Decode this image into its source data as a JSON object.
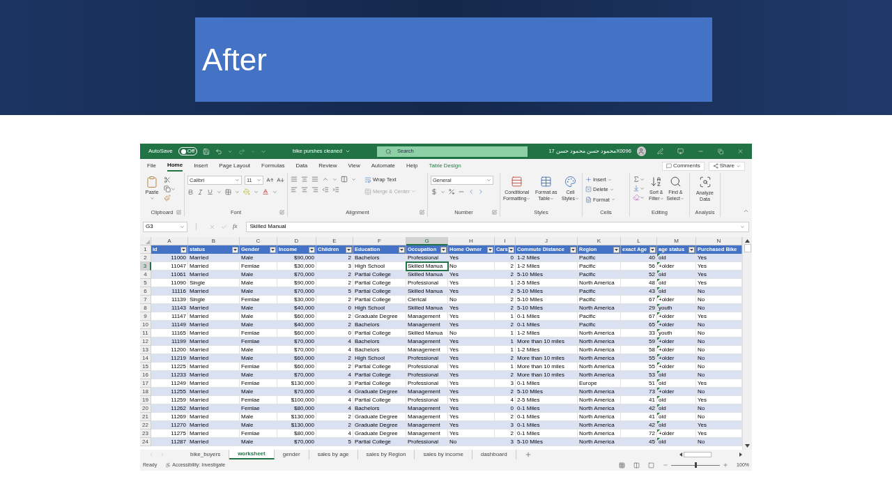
{
  "slide": {
    "title": "After"
  },
  "excel": {
    "title_bar": {
      "autosave_label": "AutoSave",
      "autosave": {
        "label": "Off",
        "on": false
      },
      "filename": "bike purshes cleaned",
      "search_placeholder": "Search",
      "user": "17 محمود حسن محمود حسنX0096"
    },
    "menu_tabs": [
      {
        "label": "File",
        "selected": false,
        "kind": "standard"
      },
      {
        "label": "Home",
        "selected": true,
        "kind": "standard"
      },
      {
        "label": "Insert",
        "selected": false,
        "kind": "standard"
      },
      {
        "label": "Page Layout",
        "selected": false,
        "kind": "standard"
      },
      {
        "label": "Formulas",
        "selected": false,
        "kind": "standard"
      },
      {
        "label": "Data",
        "selected": false,
        "kind": "standard"
      },
      {
        "label": "Review",
        "selected": false,
        "kind": "standard"
      },
      {
        "label": "View",
        "selected": false,
        "kind": "standard"
      },
      {
        "label": "Automate",
        "selected": false,
        "kind": "standard"
      },
      {
        "label": "Help",
        "selected": false,
        "kind": "standard"
      },
      {
        "label": "Table Design",
        "selected": false,
        "kind": "contextual"
      }
    ],
    "comments_button": "Comments",
    "share_button": "Share",
    "ribbon": {
      "paste": "Paste",
      "font_name": "Calibri",
      "font_size": "11",
      "wrap_text": "Wrap Text",
      "merge": {
        "label": "Merge & Center",
        "disabled": true
      },
      "number_format": "General",
      "styles": [
        {
          "kind": "conditional",
          "lines": [
            "Conditional",
            "Formatting"
          ]
        },
        {
          "kind": "table",
          "lines": [
            "Format as",
            "Table"
          ]
        },
        {
          "kind": "cell",
          "lines": [
            "Cell",
            "Styles"
          ]
        }
      ],
      "cells": [
        {
          "kind": "insert",
          "label": "Insert"
        },
        {
          "kind": "delete",
          "label": "Delete"
        },
        {
          "kind": "format",
          "label": "Format"
        }
      ],
      "editing": [
        {
          "kind": "sort",
          "lines": [
            "Sort &",
            "Filter"
          ]
        },
        {
          "kind": "find",
          "lines": [
            "Find &",
            "Select"
          ]
        }
      ],
      "analyze": [
        "Analyze",
        "Data"
      ],
      "groups": [
        {
          "label": "Clipboard",
          "launcher": true
        },
        {
          "label": "Font",
          "launcher": true
        },
        {
          "label": "Alignment",
          "launcher": true
        },
        {
          "label": "Number",
          "launcher": true
        },
        {
          "label": "Styles",
          "launcher": false
        },
        {
          "label": "Cells",
          "launcher": false
        },
        {
          "label": "Editing",
          "launcher": false
        },
        {
          "label": "Analysis",
          "launcher": false
        }
      ]
    },
    "name_box": "G3",
    "formula": "Skilled Manual",
    "header_row_num": "1",
    "function_label": "fx",
    "columns": [
      {
        "letter": "A",
        "header": "id",
        "kind": "number",
        "filter": true,
        "selected": false,
        "flagged": false
      },
      {
        "letter": "B",
        "header": "status",
        "kind": "text",
        "filter": true,
        "selected": false,
        "flagged": false
      },
      {
        "letter": "C",
        "header": "Gender",
        "kind": "text",
        "filter": true,
        "selected": false,
        "flagged": false
      },
      {
        "letter": "D",
        "header": "Income",
        "kind": "number",
        "filter": true,
        "selected": false,
        "flagged": false
      },
      {
        "letter": "E",
        "header": "Children",
        "kind": "number",
        "filter": true,
        "selected": false,
        "flagged": false
      },
      {
        "letter": "F",
        "header": "Education",
        "kind": "text",
        "filter": true,
        "selected": false,
        "flagged": false
      },
      {
        "letter": "G",
        "header": "Occupation",
        "kind": "text",
        "filter": true,
        "selected": true,
        "flagged": false
      },
      {
        "letter": "H",
        "header": "Home Owner",
        "kind": "text",
        "filter": true,
        "selected": false,
        "flagged": false
      },
      {
        "letter": "I",
        "header": "Cars",
        "kind": "number",
        "filter": true,
        "selected": false,
        "flagged": false
      },
      {
        "letter": "J",
        "header": "Commute Distance",
        "kind": "text",
        "filter": true,
        "selected": false,
        "flagged": false
      },
      {
        "letter": "K",
        "header": "Region",
        "kind": "text",
        "filter": true,
        "selected": false,
        "flagged": false
      },
      {
        "letter": "L",
        "header": "exact Age",
        "kind": "number",
        "filter": true,
        "selected": false,
        "flagged": false
      },
      {
        "letter": "M",
        "header": "age status",
        "kind": "text",
        "filter": true,
        "selected": false,
        "flagged": true
      },
      {
        "letter": "N",
        "header": "Purchased Bike",
        "kind": "text",
        "filter": false,
        "selected": false,
        "flagged": false
      }
    ],
    "rows": [
      {
        "num": "2",
        "selected": false,
        "cells": [
          "11000",
          "Married",
          "Male",
          "$90,000",
          "2",
          "Bachelors",
          "Professional",
          "Yes",
          "0",
          "1-2 Miles",
          "Pacific",
          "40",
          "old",
          "Yes"
        ]
      },
      {
        "num": "3",
        "selected": true,
        "cells": [
          "11047",
          "Married",
          "Femlae",
          "$30,000",
          "3",
          "High School",
          "Skilled Manua",
          "No",
          "2",
          "1-2 Miles",
          "Pacific",
          "56",
          "+older",
          "Yes"
        ]
      },
      {
        "num": "4",
        "selected": false,
        "cells": [
          "11061",
          "Married",
          "Male",
          "$70,000",
          "2",
          "Partial College",
          "Skilled Manua",
          "Yes",
          "2",
          "5-10 Miles",
          "Pacific",
          "52",
          "old",
          "Yes"
        ]
      },
      {
        "num": "5",
        "selected": false,
        "cells": [
          "11090",
          "Single",
          "Male",
          "$90,000",
          "2",
          "Partial College",
          "Professional",
          "Yes",
          "1",
          "2-5 Miles",
          "North America",
          "48",
          "old",
          "Yes"
        ]
      },
      {
        "num": "6",
        "selected": false,
        "cells": [
          "11116",
          "Married",
          "Male",
          "$70,000",
          "5",
          "Partial College",
          "Skilled Manua",
          "Yes",
          "2",
          "5-10 Miles",
          "Pacific",
          "43",
          "old",
          "No"
        ]
      },
      {
        "num": "7",
        "selected": false,
        "cells": [
          "11139",
          "Single",
          "Femlae",
          "$30,000",
          "2",
          "Partial College",
          "Clerical",
          "No",
          "2",
          "5-10 Miles",
          "Pacific",
          "67",
          "+older",
          "No"
        ]
      },
      {
        "num": "8",
        "selected": false,
        "cells": [
          "11143",
          "Married",
          "Male",
          "$40,000",
          "0",
          "High School",
          "Skilled Manua",
          "Yes",
          "2",
          "5-10 Miles",
          "North America",
          "29",
          "youth",
          "No"
        ]
      },
      {
        "num": "9",
        "selected": false,
        "cells": [
          "11147",
          "Married",
          "Male",
          "$60,000",
          "2",
          "Graduate Degree",
          "Management",
          "Yes",
          "1",
          "0-1 Miles",
          "Pacific",
          "67",
          "+older",
          "Yes"
        ]
      },
      {
        "num": "10",
        "selected": false,
        "cells": [
          "11149",
          "Married",
          "Male",
          "$40,000",
          "2",
          "Bachelors",
          "Management",
          "Yes",
          "2",
          "0-1 Miles",
          "Pacific",
          "65",
          "+older",
          "No"
        ]
      },
      {
        "num": "11",
        "selected": false,
        "cells": [
          "11165",
          "Married",
          "Femlae",
          "$60,000",
          "0",
          "Partial College",
          "Skilled Manua",
          "No",
          "1",
          "1-2 Miles",
          "North America",
          "33",
          "youth",
          "No"
        ]
      },
      {
        "num": "12",
        "selected": false,
        "cells": [
          "11199",
          "Married",
          "Femlae",
          "$70,000",
          "4",
          "Bachelors",
          "Management",
          "Yes",
          "1",
          "More than 10 miles",
          "North America",
          "59",
          "+older",
          "No"
        ]
      },
      {
        "num": "13",
        "selected": false,
        "cells": [
          "11200",
          "Married",
          "Male",
          "$70,000",
          "4",
          "Bachelors",
          "Management",
          "Yes",
          "1",
          "1-2 Miles",
          "North America",
          "58",
          "+older",
          "No"
        ]
      },
      {
        "num": "14",
        "selected": false,
        "cells": [
          "11219",
          "Married",
          "Male",
          "$60,000",
          "2",
          "High School",
          "Professional",
          "Yes",
          "2",
          "More than 10 miles",
          "North America",
          "55",
          "+older",
          "No"
        ]
      },
      {
        "num": "15",
        "selected": false,
        "cells": [
          "11225",
          "Married",
          "Femlae",
          "$60,000",
          "2",
          "Partial College",
          "Professional",
          "Yes",
          "1",
          "More than 10 miles",
          "North America",
          "55",
          "+older",
          "No"
        ]
      },
      {
        "num": "16",
        "selected": false,
        "cells": [
          "11233",
          "Married",
          "Male",
          "$70,000",
          "4",
          "Partial College",
          "Professional",
          "Yes",
          "2",
          "More than 10 miles",
          "North America",
          "53",
          "old",
          "No"
        ]
      },
      {
        "num": "17",
        "selected": false,
        "cells": [
          "11249",
          "Married",
          "Femlae",
          "$130,000",
          "3",
          "Partial College",
          "Professional",
          "Yes",
          "3",
          "0-1 Miles",
          "Europe",
          "51",
          "old",
          "Yes"
        ]
      },
      {
        "num": "18",
        "selected": false,
        "cells": [
          "11255",
          "Married",
          "Male",
          "$70,000",
          "4",
          "Graduate Degree",
          "Management",
          "Yes",
          "2",
          "5-10 Miles",
          "North America",
          "73",
          "+older",
          "No"
        ]
      },
      {
        "num": "19",
        "selected": false,
        "cells": [
          "11259",
          "Married",
          "Femlae",
          "$100,000",
          "4",
          "Partial College",
          "Professional",
          "Yes",
          "4",
          "2-5 Miles",
          "North America",
          "41",
          "old",
          "Yes"
        ]
      },
      {
        "num": "20",
        "selected": false,
        "cells": [
          "11262",
          "Married",
          "Femlae",
          "$80,000",
          "4",
          "Bachelors",
          "Management",
          "Yes",
          "0",
          "0-1 Miles",
          "North America",
          "42",
          "old",
          "No"
        ]
      },
      {
        "num": "21",
        "selected": false,
        "cells": [
          "11269",
          "Married",
          "Male",
          "$130,000",
          "2",
          "Graduate Degree",
          "Management",
          "Yes",
          "2",
          "0-1 Miles",
          "North America",
          "41",
          "old",
          "No"
        ]
      },
      {
        "num": "22",
        "selected": false,
        "cells": [
          "11270",
          "Married",
          "Male",
          "$130,000",
          "2",
          "Graduate Degree",
          "Management",
          "Yes",
          "3",
          "0-1 Miles",
          "North America",
          "42",
          "old",
          "Yes"
        ]
      },
      {
        "num": "23",
        "selected": false,
        "cells": [
          "11275",
          "Married",
          "Femlae",
          "$80,000",
          "4",
          "Graduate Degree",
          "Management",
          "Yes",
          "2",
          "0-1 Miles",
          "North America",
          "72",
          "+older",
          "Yes"
        ]
      },
      {
        "num": "24",
        "selected": false,
        "cells": [
          "11287",
          "Married",
          "Male",
          "$70,000",
          "5",
          "Partial College",
          "Professional",
          "No",
          "3",
          "5-10 Miles",
          "North America",
          "45",
          "old",
          "No"
        ]
      }
    ],
    "sheet_tabs": [
      {
        "label": "bike_buyers",
        "selected": false
      },
      {
        "label": "worksheet",
        "selected": true
      },
      {
        "label": "gender",
        "selected": false
      },
      {
        "label": "sales by age",
        "selected": false
      },
      {
        "label": "sales by Region",
        "selected": false
      },
      {
        "label": "sales by income",
        "selected": false
      },
      {
        "label": "dashboard",
        "selected": false
      }
    ],
    "status": {
      "ready": "Ready",
      "accessibility": "Accessibility: Investigate",
      "zoom": "100%",
      "zoom_slider": {
        "level": 0.5
      }
    }
  }
}
